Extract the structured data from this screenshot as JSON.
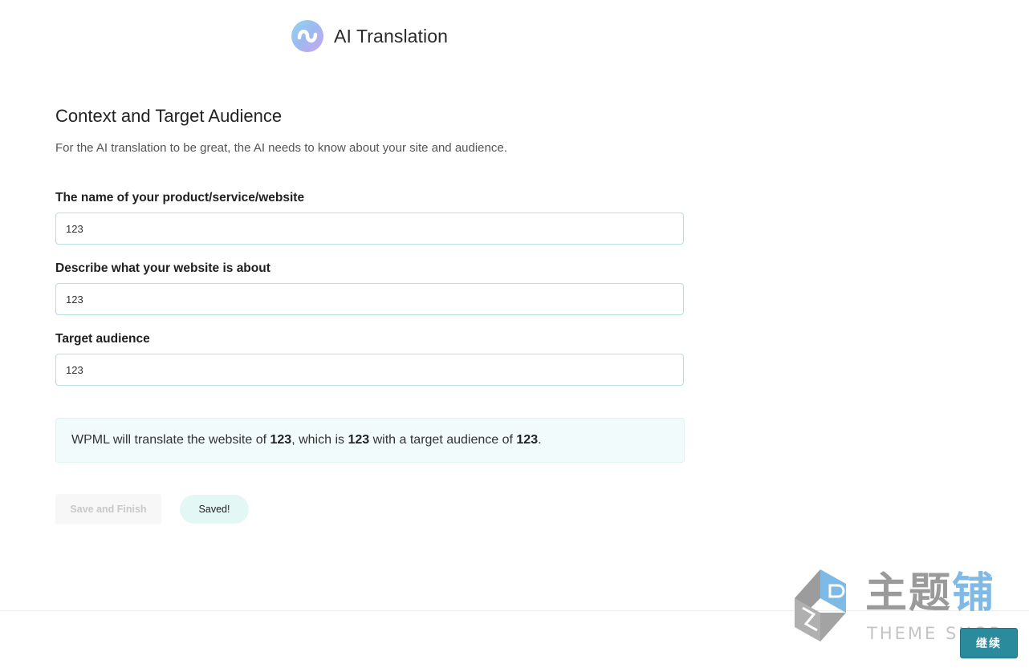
{
  "header": {
    "title": "AI Translation",
    "logo_icon": "ai-translation-logo-icon"
  },
  "section": {
    "title": "Context and Target Audience",
    "description": "For the AI translation to be great, the AI needs to know about your site and audience."
  },
  "fields": [
    {
      "label": "The name of your product/service/website",
      "value": "123"
    },
    {
      "label": "Describe what your website is about",
      "value": "123"
    },
    {
      "label": "Target audience",
      "value": "123"
    }
  ],
  "summary": {
    "part1": "WPML will translate the website of ",
    "product": "123",
    "part2": ", which is ",
    "about": "123",
    "part3": " with a target audience of ",
    "audience": "123",
    "part4": "."
  },
  "actions": {
    "save_label": "Save and Finish",
    "saved_label": "Saved!"
  },
  "footer": {
    "continue_label": "继续"
  },
  "watermark": {
    "cn_part1": "主题",
    "cn_part2": "铺",
    "en": "THEME SHOP"
  },
  "colors": {
    "accent": "#2a8b9c",
    "input_border": "#b8dfe0",
    "summary_bg": "#f2fbfb",
    "saved_bg": "#e3f8f4"
  }
}
